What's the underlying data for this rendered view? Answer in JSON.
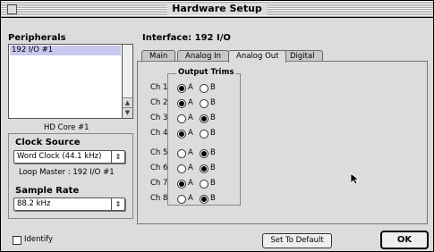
{
  "window": {
    "title": "Hardware Setup"
  },
  "peripherals": {
    "label": "Peripherals",
    "items": [
      "192 I/O #1"
    ],
    "caption": "HD Core #1"
  },
  "clock": {
    "label": "Clock Source",
    "selected": "Word Clock (44.1 kHz)",
    "loop_master": "Loop Master : 192 I/O #1"
  },
  "sample_rate": {
    "label": "Sample Rate",
    "selected": "88.2 kHz"
  },
  "interface": {
    "label": "Interface: 192 I/O"
  },
  "tabs": [
    {
      "label": "Main",
      "active": false
    },
    {
      "label": "Analog In",
      "active": false
    },
    {
      "label": "Analog Out",
      "active": true
    },
    {
      "label": "Digital",
      "active": false
    }
  ],
  "output_trims": {
    "label": "Output Trims",
    "option_a": "A",
    "option_b": "B",
    "channels": [
      {
        "label": "Ch 1",
        "selected": "A"
      },
      {
        "label": "Ch 2",
        "selected": "A"
      },
      {
        "label": "Ch 3",
        "selected": "B"
      },
      {
        "label": "Ch 4",
        "selected": "A"
      },
      {
        "label": "Ch 5",
        "selected": "B"
      },
      {
        "label": "Ch 6",
        "selected": "B"
      },
      {
        "label": "Ch 7",
        "selected": "A"
      },
      {
        "label": "Ch 8",
        "selected": "B"
      }
    ]
  },
  "footer": {
    "identify": "Identify",
    "set_default": "Set To Default",
    "ok": "OK"
  },
  "popup_arrows": "⇕"
}
